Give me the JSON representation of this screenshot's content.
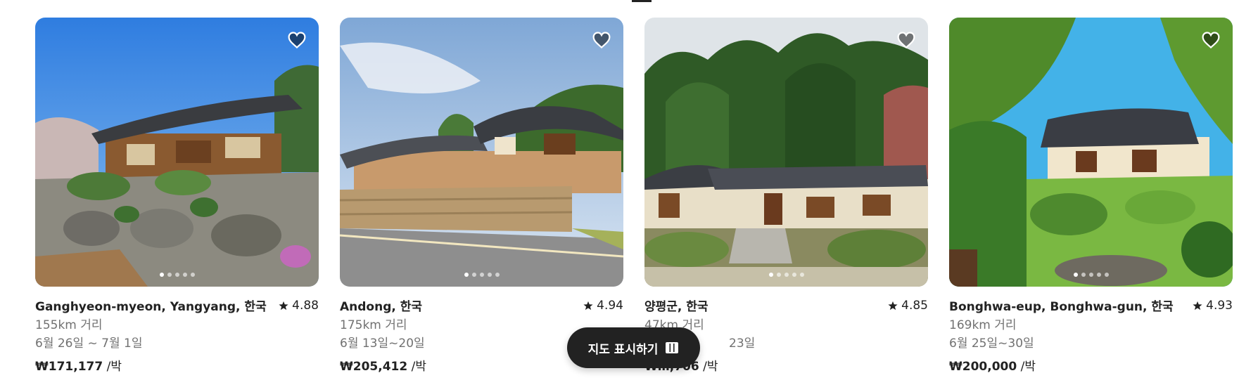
{
  "listings": [
    {
      "location": "Ganghyeon-myeon, Yangyang, 한국",
      "rating": "4.88",
      "distance": "155km 거리",
      "dates": "6월 26일 ~ 7월 1일",
      "price": "₩171,177",
      "price_unit": "/박",
      "photo": "hanok-rock-garden"
    },
    {
      "location": "Andong, 한국",
      "rating": "4.94",
      "distance": "175km 거리",
      "dates": "6월 13일~20일",
      "price": "₩205,412",
      "price_unit": "/박",
      "photo": "hanok-stone-wall"
    },
    {
      "location": "양평군, 한국",
      "rating": "4.85",
      "distance": "47km 거리",
      "dates": "23일",
      "price": "₩…,706",
      "price_unit": "/박",
      "photo": "hanok-forest"
    },
    {
      "location": "Bonghwa-eup, Bonghwa-gun, 한국",
      "rating": "4.93",
      "distance": "169km 거리",
      "dates": "6월 25일~30일",
      "price": "₩200,000",
      "price_unit": "/박",
      "photo": "hanok-garden-pond"
    }
  ],
  "map_button": {
    "label": "지도 표시하기",
    "icon": "map-icon"
  },
  "icons": {
    "favorite": "heart-icon",
    "rating": "star-icon"
  },
  "colors": {
    "text_primary": "#222222",
    "text_secondary": "#717171",
    "button_bg": "#222222",
    "heart_fill": "rgba(0,0,0,0.5)"
  }
}
